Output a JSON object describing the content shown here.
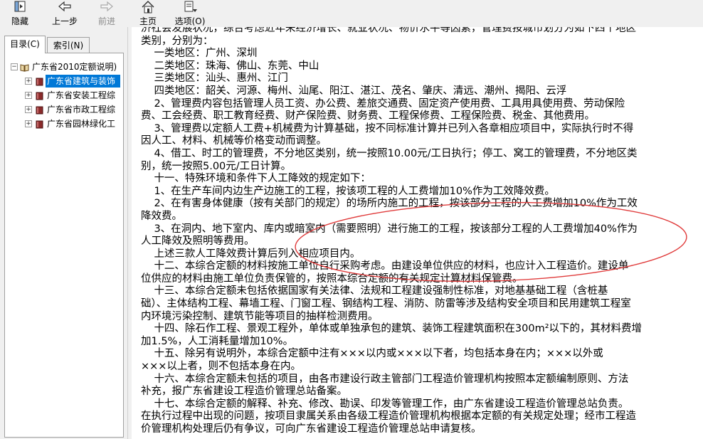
{
  "toolbar": {
    "hide": "隐藏",
    "back": "上一步",
    "forward": "前进",
    "home": "主页",
    "options": "选项(O)"
  },
  "tabs": {
    "contents": "目录(C)",
    "index": "索引(N)"
  },
  "tree": {
    "root": "广东省2010定额说明)",
    "children": [
      "广东省建筑与装饰",
      "广东省安装工程综",
      "广东省市政工程综",
      "广东省园林绿化工"
    ]
  },
  "doc": {
    "lines": [
      "济社会发展状况，综合考虑近年来经济增长、就业状况、物价水平等因素，管理费按城市划分为如下四个地区",
      "类别，分别为：",
      "    一类地区：广州、深圳",
      "    二类地区：珠海、佛山、东莞、中山",
      "    三类地区：汕头、惠州、江门",
      "    四类地区：韶关、河源、梅州、汕尾、阳江、湛江、茂名、肇庆、清远、潮州、揭阳、云浮",
      "    2、管理费内容包括管理人员工资、办公费、差旅交通费、固定资产使用费、工具用具使用费、劳动保险",
      "费、工会经费、职工教育经费、财产保险费、财务费、工程保修费、工程保险费、税金、其他费用。",
      "    3、管理费以定额人工费+机械费为计算基础，按不同标准计算并已列入各章相应项目中，实际执行时不得",
      "因人工、材料、机械等价格变动而调整。",
      "    4、借工、时工的管理费，不分地区类别，统一按照10.00元/工日执行；停工、窝工的管理费，不分地区类",
      "别，统一按照5.00元/工日计算。",
      "    十一、特殊环境和条件下人工降效的规定如下：",
      "    1、在生产车间内边生产边施工的工程，按该项工程的人工费增加10%作为工效降效费。",
      "    2、在有害身体健康（按有关部门的规定）的场所内施工的工程，按该部分工程的人工费增加10%作为工效",
      "降效费。",
      "    3、在洞内、地下室内、库内或暗室内（需要照明）进行施工的工程，按该部分工程的人工费增加40%作为",
      "人工降效及照明等费用。",
      "    上述三款人工降效费计算后列入相应项目内。",
      "    十二、本综合定额的材料按施工单位自行采购考虑。由建设单位供应的材料，也应计入工程造价。建设单",
      "位供应的材料由施工单位负责保管的，按照本综合定额的有关规定计算材料保管费。",
      "    十三、本综合定额未包括依据国家有关法律、法规和工程建设强制性标准，对地基基础工程（含桩基",
      "础）、主体结构工程、幕墙工程、门窗工程、钢结构工程、消防、防雷等涉及结构安全项目和民用建筑工程室",
      "内环境污染控制、建筑节能等项目的抽样检测费用。",
      "    十四、除石作工程、景观工程外，单体或单独承包的建筑、装饰工程建筑面积在300m²以下的，其材料费增",
      "加1.5%，人工消耗量增加10%。",
      "    十五、除另有说明外，本综合定额中注有×××以内或×××以下者，均包括本身在内；×××以外或",
      "×××以上者，则不包括本身在内。",
      "    十六、本综合定额未包括的项目，由各市建设行政主管部门工程造价管理机构按照本定额编制原则、方法",
      "补充，报广东省建设工程造价管理总站备案。",
      "    十七、本综合定额的解释、补充、修改、勘误、印发等管理工作，由广东省建设工程造价管理总站负责。",
      "在执行过程中出现的问题，按项目隶属关系由各级工程造价管理机构根据本定额的有关规定处理；经市工程造",
      "价管理机构处理后仍有争议，可向广东省建设工程造价管理总站申请复核。"
    ]
  },
  "colors": {
    "selection": "#0078d7",
    "annotation": "#e03c3c"
  }
}
